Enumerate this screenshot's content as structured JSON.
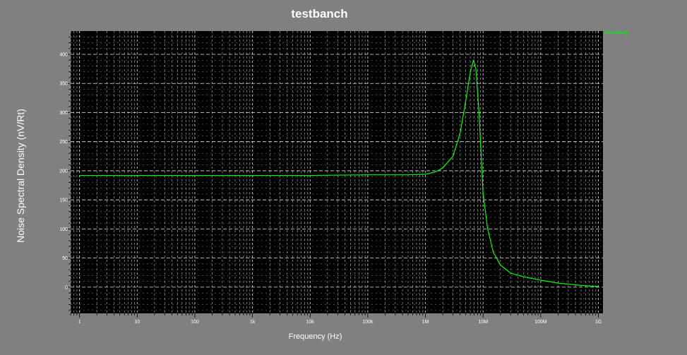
{
  "chart_data": {
    "type": "line",
    "title": "testbanch",
    "xlabel": "Frequency (Hz)",
    "ylabel": "Noise Spectral Density (nV/Rt)",
    "x_scale": "log",
    "xlim": [
      0.7,
      1200000000
    ],
    "ylim": [
      -45,
      440
    ],
    "grid": true,
    "x_ticks": [
      1,
      10,
      100,
      1000,
      10000,
      100000,
      1000000,
      10000000,
      100000000,
      1000000000
    ],
    "x_tick_labels": [
      "1",
      "10",
      "100",
      "1k",
      "10k",
      "100k",
      "1M",
      "10M",
      "100M",
      "1G"
    ],
    "y_ticks": [
      0,
      50,
      100,
      150,
      200,
      250,
      300,
      350,
      400
    ],
    "y_tick_labels": [
      "0",
      "50",
      "100",
      "150",
      "200",
      "250",
      "300",
      "350",
      "400"
    ],
    "legend_position": "top-right",
    "legend": [
      "onoise(mag)"
    ],
    "colors": {
      "background": "#808080",
      "plot_area": "#000000",
      "grid": "#ffffff",
      "series": "#00ff00",
      "text": "#ffffff"
    },
    "series": [
      {
        "name": "onoise(mag)",
        "x": [
          1,
          10,
          100,
          1000,
          10000,
          100000,
          500000,
          1000000,
          1500000,
          2000000,
          3000000,
          4000000,
          5000000,
          6000000,
          6800000,
          7500000,
          8500000,
          10000000,
          12000000,
          15000000,
          20000000,
          30000000,
          50000000,
          100000000,
          200000000,
          500000000,
          1000000000
        ],
        "y": [
          192,
          192,
          192,
          192,
          192,
          193,
          193,
          194,
          198,
          205,
          225,
          265,
          320,
          370,
          390,
          375,
          300,
          160,
          100,
          60,
          38,
          24,
          18,
          12,
          7,
          3,
          1
        ]
      }
    ]
  }
}
